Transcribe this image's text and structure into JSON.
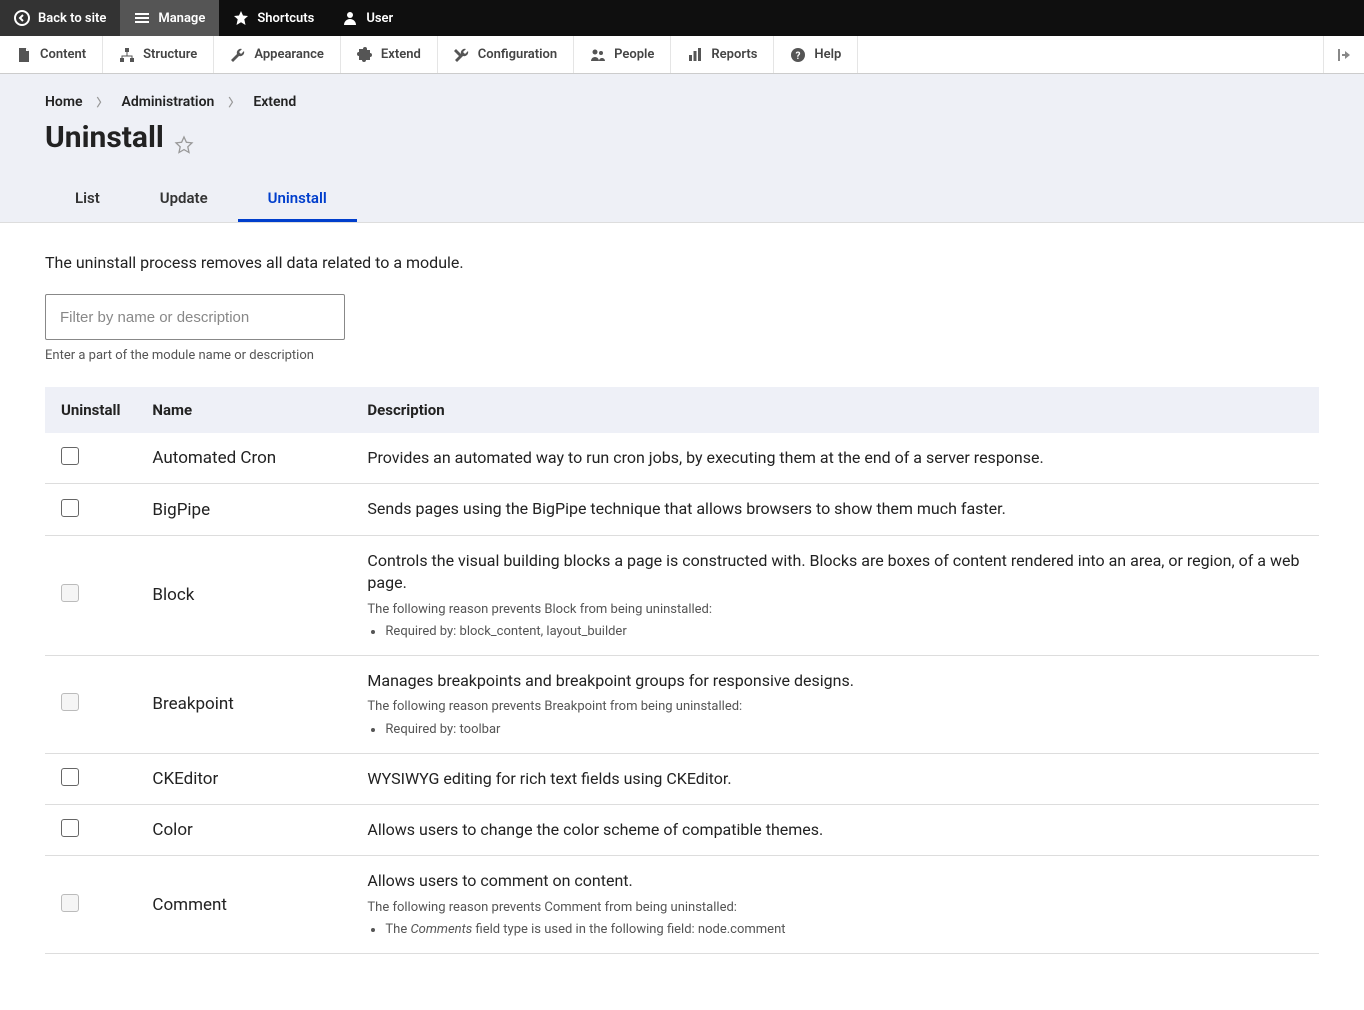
{
  "toolbar_top": {
    "back": "Back to site",
    "manage": "Manage",
    "shortcuts": "Shortcuts",
    "user": "User"
  },
  "toolbar_sec": {
    "content": "Content",
    "structure": "Structure",
    "appearance": "Appearance",
    "extend": "Extend",
    "configuration": "Configuration",
    "people": "People",
    "reports": "Reports",
    "help": "Help"
  },
  "breadcrumb": {
    "home": "Home",
    "admin": "Administration",
    "extend": "Extend"
  },
  "page_title": "Uninstall",
  "tabs": {
    "list": "List",
    "update": "Update",
    "uninstall": "Uninstall"
  },
  "intro": "The uninstall process removes all data related to a module.",
  "filter": {
    "placeholder": "Filter by name or description",
    "help": "Enter a part of the module name or description"
  },
  "table_headers": {
    "uninstall": "Uninstall",
    "name": "Name",
    "description": "Description"
  },
  "modules": [
    {
      "name": "Automated Cron",
      "description": "Provides an automated way to run cron jobs, by executing them at the end of a server response.",
      "disabled": false
    },
    {
      "name": "BigPipe",
      "description": "Sends pages using the BigPipe technique that allows browsers to show them much faster.",
      "disabled": false
    },
    {
      "name": "Block",
      "description": "Controls the visual building blocks a page is constructed with. Blocks are boxes of content rendered into an area, or region, of a web page.",
      "disabled": true,
      "reason_intro": "The following reason prevents Block from being uninstalled:",
      "reason": "Required by: block_content, layout_builder"
    },
    {
      "name": "Breakpoint",
      "description": "Manages breakpoints and breakpoint groups for responsive designs.",
      "disabled": true,
      "reason_intro": "The following reason prevents Breakpoint from being uninstalled:",
      "reason": "Required by: toolbar"
    },
    {
      "name": "CKEditor",
      "description": "WYSIWYG editing for rich text fields using CKEditor.",
      "disabled": false
    },
    {
      "name": "Color",
      "description": "Allows users to change the color scheme of compatible themes.",
      "disabled": false
    },
    {
      "name": "Comment",
      "description": "Allows users to comment on content.",
      "disabled": true,
      "reason_intro": "The following reason prevents Comment from being uninstalled:",
      "reason_html": "The <em>Comments</em> field type is used in the following field: node.comment"
    }
  ]
}
